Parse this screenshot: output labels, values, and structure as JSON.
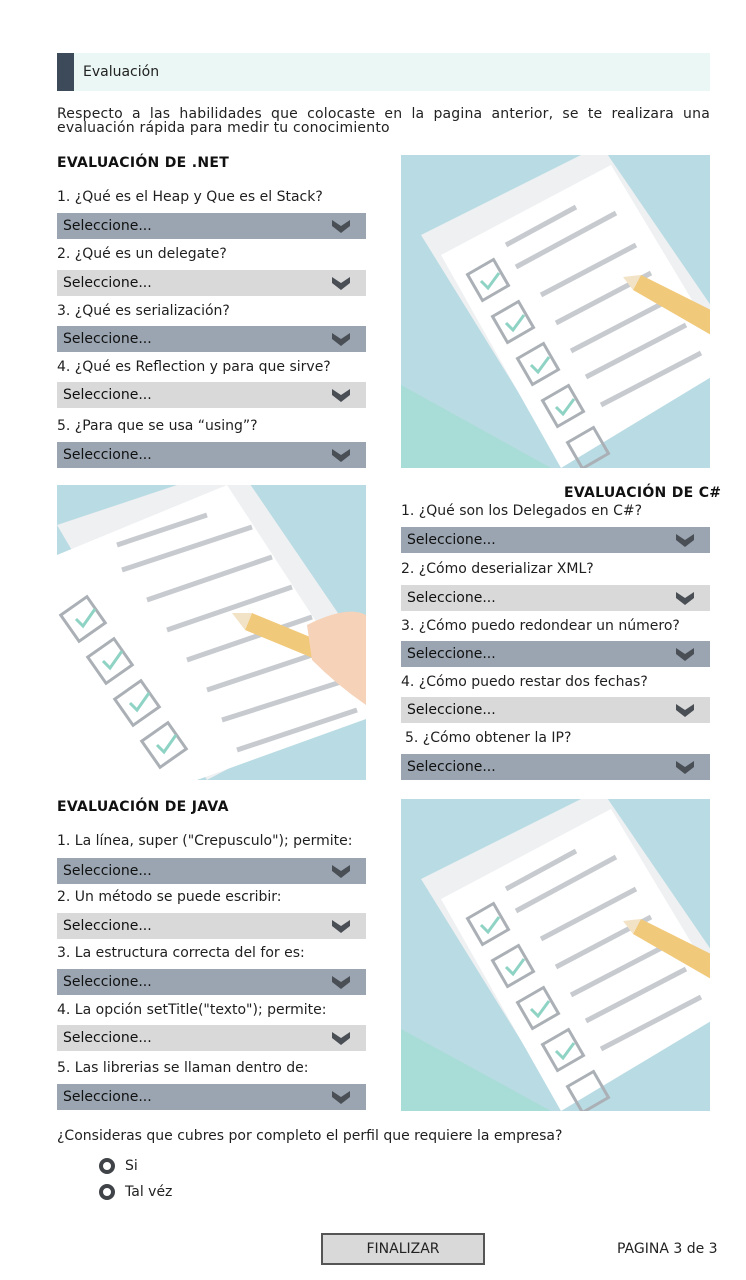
{
  "header": {
    "title": "Evaluación"
  },
  "intro": "Respecto a las habilidades que colocaste en la pagina anterior, se te realizara una evaluación rápida para medir tu conocimiento",
  "select_placeholder": "Seleccione...",
  "net": {
    "title": "EVALUACIÓN DE .NET",
    "questions": [
      "1. ¿Qué es el Heap y Que es el Stack?",
      "2. ¿Qué es un delegate?",
      "3. ¿Qué es serialización?",
      "4. ¿Qué es Reflection y para que sirve?",
      "5. ¿Para que se usa “using”?"
    ]
  },
  "csharp": {
    "title": "EVALUACIÓN DE C#",
    "questions": [
      "1. ¿Qué son los Delegados en C#?",
      "2. ¿Cómo deserializar XML?",
      "3. ¿Cómo puedo redondear un número?",
      "4. ¿Cómo puedo restar dos fechas?",
      "5. ¿Cómo obtener la IP?"
    ]
  },
  "java": {
    "title": "EVALUACIÓN DE JAVA",
    "questions": [
      "1. La línea, super (\"Crepusculo\"); permite:",
      "2. Un método se puede escribir:",
      "3. La estructura correcta del for es:",
      "4. La opción setTitle(\"texto\"); permite:",
      "5. Las librerias se llaman dentro de:"
    ]
  },
  "profile": {
    "question": "¿Consideras que cubres por completo el perfil que requiere la empresa?",
    "options": [
      "Si",
      "Tal véz"
    ]
  },
  "footer": {
    "finish_label": "FINALIZAR",
    "page_label": "PAGINA  3 de 3"
  },
  "colors": {
    "header_bg": "#eaf7f4",
    "header_accent": "#3d4a59",
    "select_dark": "#9aa5b1",
    "select_light": "#d9d9d9",
    "chevron": "#4a4f56"
  }
}
